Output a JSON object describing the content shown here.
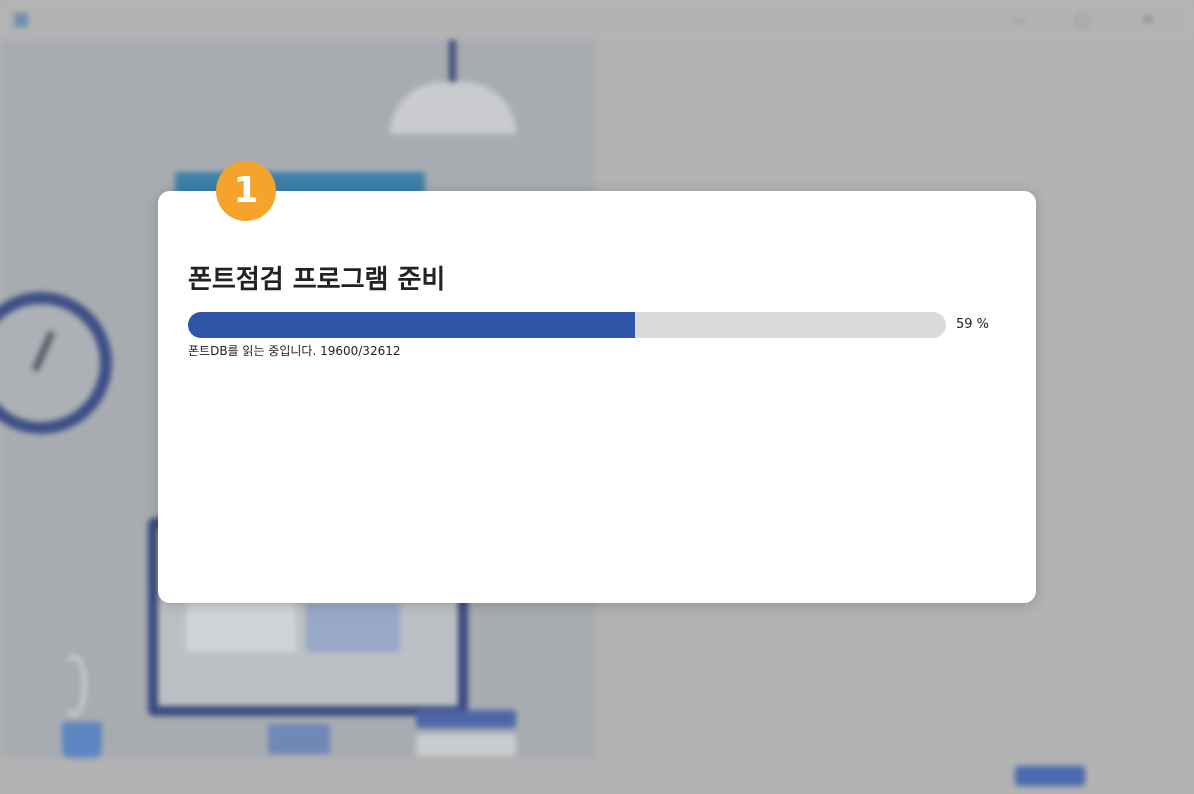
{
  "dialog": {
    "step_number": "1",
    "title": "폰트점검 프로그램 준비",
    "progress": {
      "percent": 59,
      "percent_label": "59 %"
    },
    "status_text": "폰트DB를 읽는 중입니다. 19600/32612"
  },
  "colors": {
    "badge": "#f6a32c",
    "progress_fill": "#2f55a8",
    "progress_track": "#dadada"
  }
}
